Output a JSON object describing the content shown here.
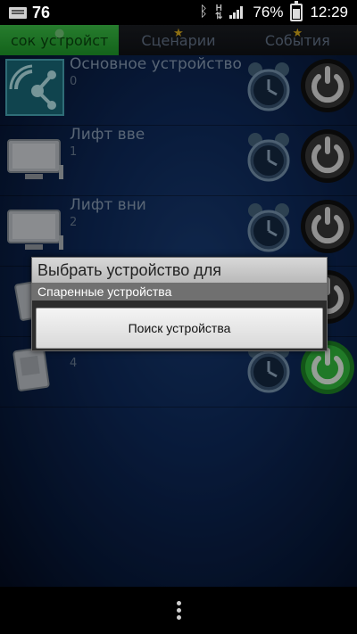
{
  "status_bar": {
    "notification_count": "76",
    "battery_percent": "76%",
    "time": "12:29",
    "icons": [
      "mail-icon",
      "bluetooth-icon",
      "hspa-icon",
      "signal-icon",
      "battery-icon"
    ]
  },
  "tabs": [
    {
      "label": "сок устройст",
      "active": true
    },
    {
      "label": "Сценарии",
      "active": false
    },
    {
      "label": "События",
      "active": false
    }
  ],
  "devices": [
    {
      "name": "Основное устройство",
      "id": "0",
      "power_state": "off"
    },
    {
      "name": "Лифт вве",
      "id": "1",
      "power_state": "off"
    },
    {
      "name": "Лифт вни",
      "id": "2",
      "power_state": "off"
    },
    {
      "name": "",
      "id": "",
      "power_state": "off"
    },
    {
      "name": "",
      "id": "4",
      "power_state": "on"
    }
  ],
  "dialog": {
    "title": "Выбрать устройство для",
    "subtitle": "Спаренные устройства",
    "button_label": "Поиск устройства"
  },
  "colors": {
    "active_tab": "#2fb83b",
    "power_on": "#35c33f",
    "star": "#e6b51e"
  }
}
